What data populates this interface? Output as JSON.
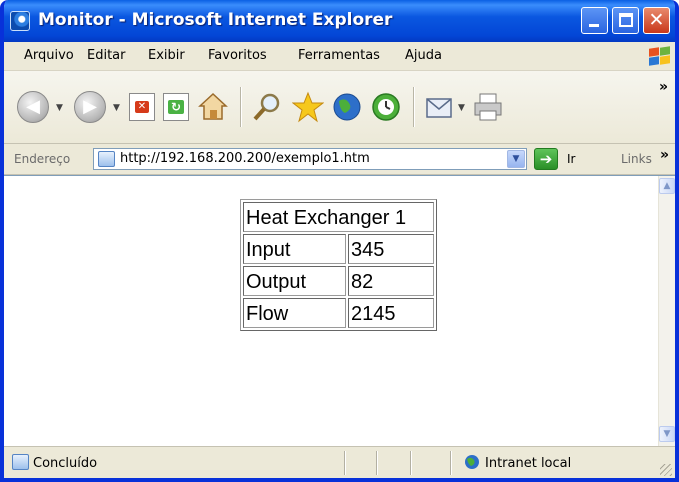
{
  "window": {
    "title": "Monitor - Microsoft Internet Explorer"
  },
  "menu": {
    "items": [
      "Arquivo",
      "Editar",
      "Exibir",
      "Favoritos",
      "Ferramentas",
      "Ajuda"
    ]
  },
  "toolbar": {
    "overflow": "»"
  },
  "address": {
    "label": "Endereço",
    "url": "http://192.168.200.200/exemplo1.htm",
    "go_label": "Ir",
    "links_label": "Links",
    "links_overflow": "»"
  },
  "content": {
    "table_title": "Heat Exchanger 1",
    "rows": [
      {
        "label": "Input",
        "value": "345"
      },
      {
        "label": "Output",
        "value": "82"
      },
      {
        "label": "Flow",
        "value": "2145"
      }
    ]
  },
  "status": {
    "text": "Concluído",
    "zone": "Intranet local"
  }
}
